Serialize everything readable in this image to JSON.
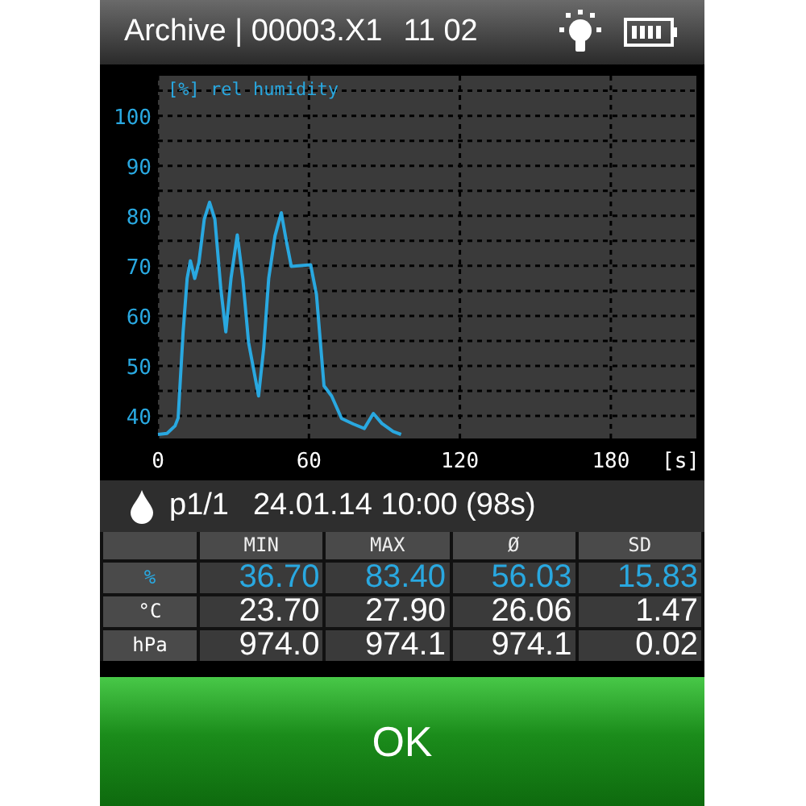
{
  "header": {
    "title": "Archive | 00003.X1",
    "code": "11 02"
  },
  "chart": {
    "chart_data": {
      "type": "line",
      "title": "[%] rel humidity",
      "xlabel": "[s]",
      "xlim": [
        0,
        214
      ],
      "ylim": [
        35.5,
        108
      ],
      "xticks": [
        0,
        60,
        120,
        180
      ],
      "yticks": [
        40,
        50,
        60,
        70,
        80,
        90,
        100
      ],
      "x": [
        0,
        3.6,
        6.8,
        8,
        10,
        11.6,
        12.9,
        14.6,
        16.3,
        18.4,
        20.5,
        22.6,
        25,
        27,
        29,
        31.5,
        33.7,
        36,
        40,
        42,
        44,
        46.5,
        49,
        51,
        53,
        60.7,
        63,
        66,
        69,
        73,
        77.6,
        82,
        85.6,
        89,
        93.5,
        96.6
      ],
      "grid": true,
      "series": [
        {
          "color": "#29a8e0",
          "values": [
            36.3,
            36.5,
            38,
            39.6,
            56.8,
            67.5,
            71,
            67.5,
            70.7,
            79.3,
            82.7,
            79.3,
            65.4,
            56.8,
            67.5,
            76.2,
            67.5,
            54.7,
            44,
            53.6,
            67.5,
            76,
            80.6,
            75,
            69.9,
            70.2,
            64.3,
            46,
            44,
            39.5,
            38.4,
            37.5,
            40.5,
            38.5,
            36.9,
            36.3
          ]
        }
      ]
    }
  },
  "record": {
    "page": "p1/1",
    "timestamp": "24.01.14 10:00 (98s)"
  },
  "table": {
    "columns": [
      "MIN",
      "MAX",
      "Ø",
      "SD"
    ],
    "rows": [
      {
        "unit": "%",
        "highlighted": true,
        "values": [
          "36.70",
          "83.40",
          "56.03",
          "15.83"
        ]
      },
      {
        "unit": "°C",
        "highlighted": false,
        "values": [
          "23.70",
          "27.90",
          "26.06",
          "1.47"
        ]
      },
      {
        "unit": "hPa",
        "highlighted": false,
        "values": [
          "974.0",
          "974.1",
          "974.1",
          "0.02"
        ]
      }
    ]
  },
  "button": {
    "label": "OK"
  }
}
